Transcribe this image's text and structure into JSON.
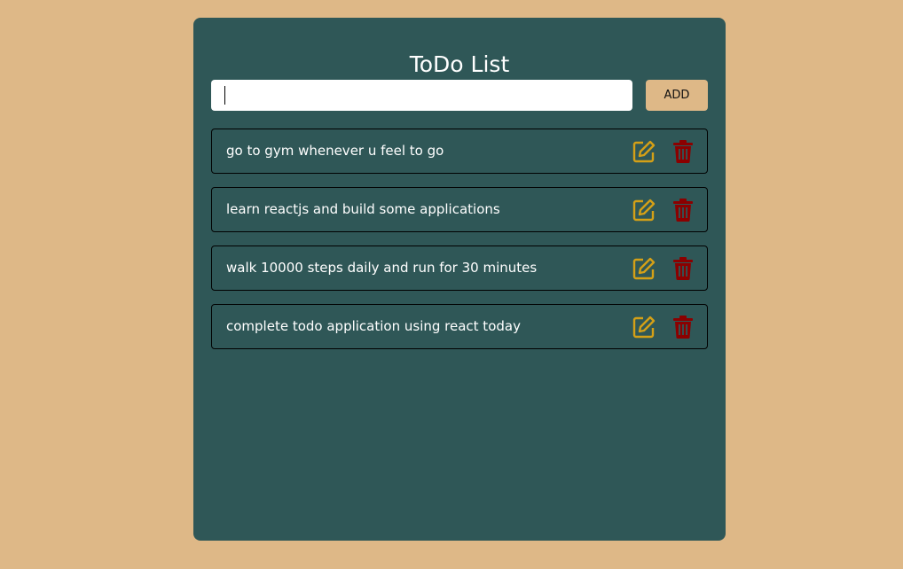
{
  "app": {
    "title": "ToDo List"
  },
  "input": {
    "value": "",
    "placeholder": ""
  },
  "add_button": {
    "label": "ADD"
  },
  "todos": [
    {
      "text": "go to gym whenever u feel to go"
    },
    {
      "text": "learn reactjs and build some applications"
    },
    {
      "text": "walk 10000 steps daily and run for 30 minutes"
    },
    {
      "text": "complete todo application using react today"
    }
  ],
  "icons": {
    "edit": "edit-icon",
    "delete": "trash-icon"
  },
  "colors": {
    "background": "#deb887",
    "card": "#2f5757",
    "edit_icon": "#d4a017",
    "delete_icon": "#8b0000",
    "text": "#ffffff"
  }
}
